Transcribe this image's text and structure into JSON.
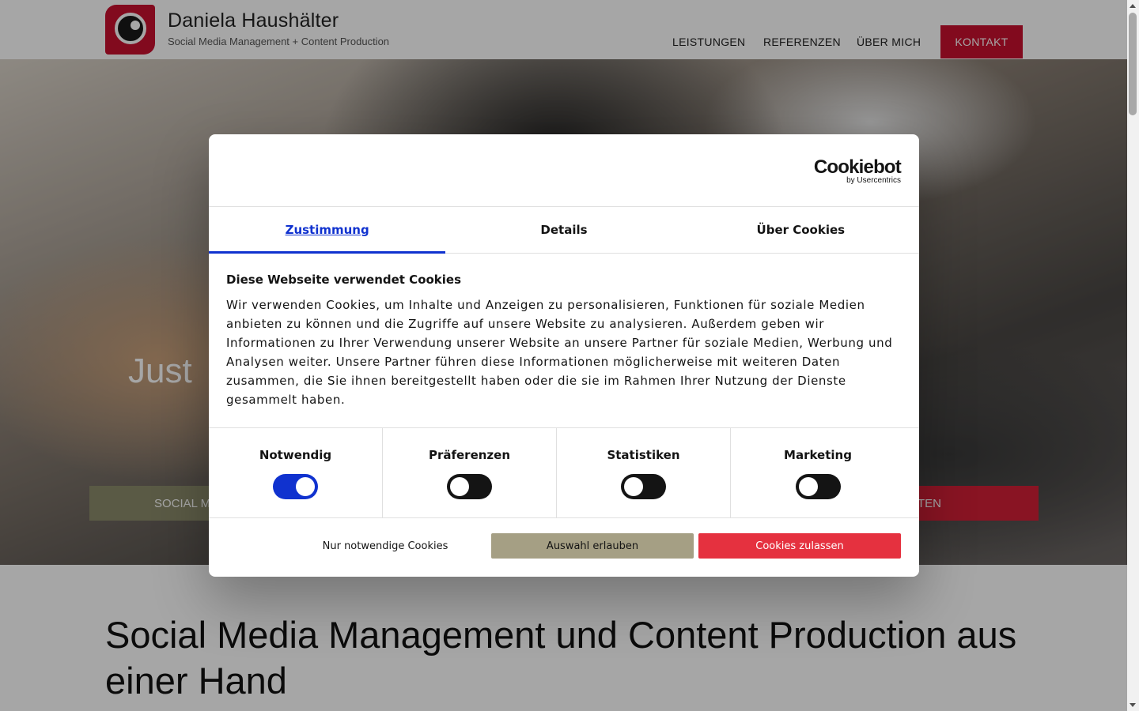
{
  "header": {
    "brand_name": "Daniela Haushälter",
    "brand_tagline": "Social Media Management + Content Production",
    "nav": [
      "LEISTUNGEN",
      "REFERENZEN",
      "ÜBER MICH"
    ],
    "cta": "KONTAKT"
  },
  "hero": {
    "headline": "Just",
    "button_left": "SOCIAL M",
    "button_right": "TEN"
  },
  "section": {
    "title": "Social Media Management und Content Production aus einer Hand"
  },
  "dialog": {
    "logo_main": "Cookiebot",
    "logo_sub": "by Usercentrics",
    "tabs": [
      "Zustimmung",
      "Details",
      "Über Cookies"
    ],
    "active_tab": "Zustimmung",
    "title": "Diese Webseite verwendet Cookies",
    "body": "Wir verwenden Cookies, um Inhalte und Anzeigen zu personalisieren, Funktionen für soziale Medien anbieten zu können und die Zugriffe auf unsere Website zu analysieren. Außerdem geben wir Informationen zu Ihrer Verwendung unserer Website an unsere Partner für soziale Medien, Werbung und Analysen weiter. Unsere Partner führen diese Informationen möglicherweise mit weiteren Daten zusammen, die Sie ihnen bereitgestellt haben oder die sie im Rahmen Ihrer Nutzung der Dienste gesammelt haben.",
    "toggles": [
      {
        "label": "Notwendig",
        "on": true
      },
      {
        "label": "Präferenzen",
        "on": false
      },
      {
        "label": "Statistiken",
        "on": false
      },
      {
        "label": "Marketing",
        "on": false
      }
    ],
    "buttons": {
      "necessary": "Nur notwendige Cookies",
      "selection": "Auswahl erlauben",
      "accept": "Cookies zulassen"
    }
  },
  "colors": {
    "accent": "#1032cf",
    "brand_red": "#c8102e",
    "accept_red": "#e5313f",
    "selection_olive": "#a59f84"
  }
}
